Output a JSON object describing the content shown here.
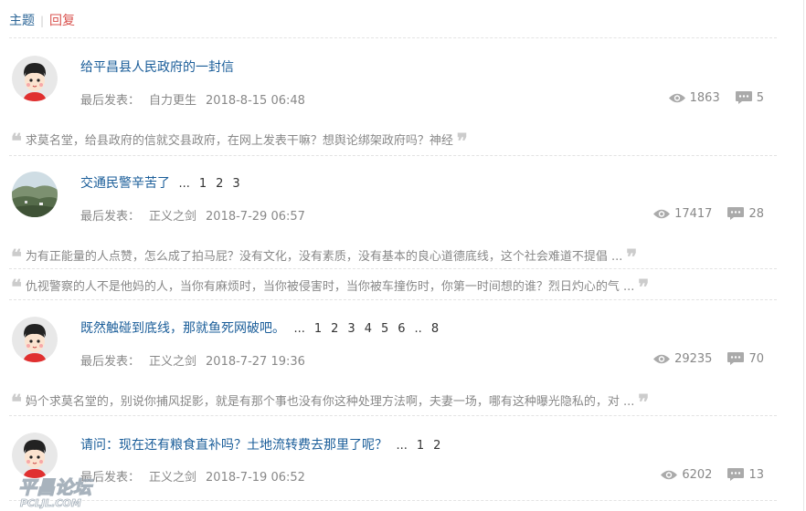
{
  "tabs": {
    "topics": "主题",
    "separator": "|",
    "replies": "回复"
  },
  "meta_label": "最后发表：",
  "threads": [
    {
      "title": "给平昌县人民政府的一封信",
      "pages": [],
      "author": "自力更生",
      "date": "2018-8-15 06:48",
      "views": "1863",
      "replies": "5",
      "avatar": "cartoon-boy",
      "quotes": [
        "求莫名堂，给县政府的信就交县政府，在网上发表干嘛？想舆论绑架政府吗？神经"
      ]
    },
    {
      "title": "交通民警辛苦了",
      "pages": [
        "...",
        "1",
        "2",
        "3"
      ],
      "author": "正义之剑",
      "date": "2018-7-29 06:57",
      "views": "17417",
      "replies": "28",
      "avatar": "landscape",
      "quotes": [
        "为有正能量的人点赞，怎么成了拍马屁？没有文化，没有素质，没有基本的良心道德底线，这个社会难道不提倡 ...",
        "仇视警察的人不是他妈的人，当你有麻烦时，当你被侵害时，当你被车撞伤时，你第一时间想的谁？烈日灼心的气 ..."
      ]
    },
    {
      "title": "既然触碰到底线，那就鱼死网破吧。",
      "pages": [
        "...",
        "1",
        "2",
        "3",
        "4",
        "5",
        "6",
        "..",
        "8"
      ],
      "author": "正义之剑",
      "date": "2018-7-27 19:36",
      "views": "29235",
      "replies": "70",
      "avatar": "cartoon-boy",
      "quotes": [
        "妈个求莫名堂的，别说你捕风捉影，就是有那个事也没有你这种处理方法啊，夫妻一场，哪有这种曝光隐私的，对 ..."
      ]
    },
    {
      "title": "请问：现在还有粮食直补吗？土地流转费去那里了呢？",
      "pages": [
        "...",
        "1",
        "2"
      ],
      "author": "正义之剑",
      "date": "2018-7-19 06:52",
      "views": "6202",
      "replies": "13",
      "avatar": "cartoon-boy",
      "quotes": []
    }
  ],
  "watermark": {
    "main": "平昌论坛",
    "sub": "PCLJL.COM"
  }
}
